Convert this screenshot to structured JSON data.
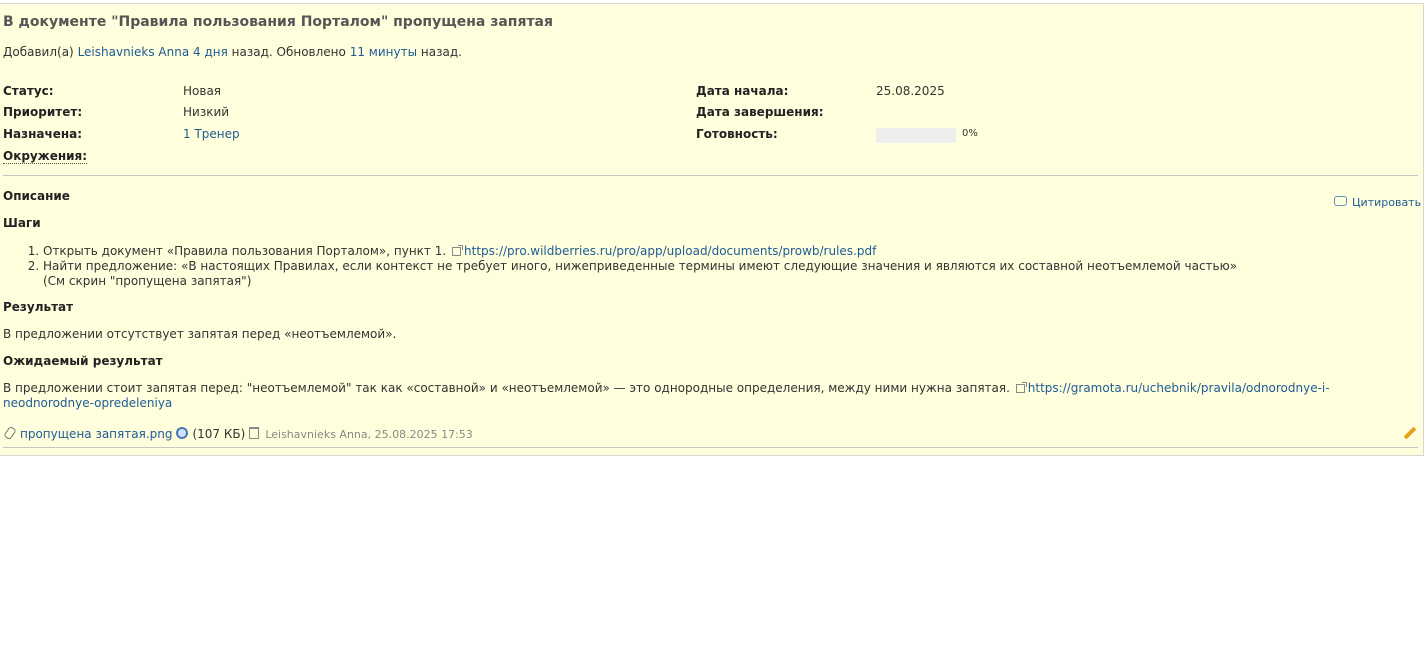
{
  "issue": {
    "subject": "В документе \"Правила пользования Порталом\" пропущена запятая",
    "author_prefix": "Добавил(а)",
    "author_name": "Leishavnieks Anna",
    "added_ago": "4 дня",
    "added_suffix": "назад. Обновлено",
    "updated_ago": "11 минуты",
    "updated_suffix": "назад."
  },
  "attributes": {
    "status_label": "Статус:",
    "status_value": "Новая",
    "priority_label": "Приоритет:",
    "priority_value": "Низкий",
    "assigned_label": "Назначена:",
    "assigned_value": "1 Тренер",
    "environment_label": "Окружения:",
    "start_date_label": "Дата начала:",
    "start_date_value": "25.08.2025",
    "due_date_label": "Дата завершения:",
    "done_label": "Готовность:",
    "done_percent_text": "0%",
    "done_ratio": 0
  },
  "description": {
    "title": "Описание",
    "quote_label": "Цитировать",
    "steps_title": "Шаги",
    "step1_text": "Открыть документ «Правила пользования Порталом», пункт 1.",
    "step1_link": "https://pro.wildberries.ru/pro/app/upload/documents/prowb/rules.pdf",
    "step2_text": "Найти предложение: «В настоящих Правилах, если контекст не требует иного, нижеприведенные термины имеют следующие значения и являются их составной неотъемлемой частью»",
    "step2_note": "(См скрин \"пропущена запятая\")",
    "result_title": "Результат",
    "result_text": "В предложении отсутствует запятая перед «неотъемлемой».",
    "expected_title": "Ожидаемый результат",
    "expected_text": "В предложении стоит запятая перед: \"неотъемлемой\" так как «составной» и «неотъемлемой» — это однородные определения, между ними нужна запятая.",
    "expected_link": "https://gramota.ru/uchebnik/pravila/odnorodnye-i-neodnorodnye-opredeleniya"
  },
  "attachment": {
    "filename": "пропущена запятая.png",
    "size": "(107 КБ)",
    "meta": "Leishavnieks Anna, 25.08.2025 17:53"
  },
  "colors": {
    "background": "#ffffdd",
    "link": "#1f5b95"
  },
  "icons": [
    "quote-icon",
    "external-link-icon",
    "paperclip-icon",
    "magnifier-icon",
    "trash-icon",
    "pencil-icon"
  ]
}
